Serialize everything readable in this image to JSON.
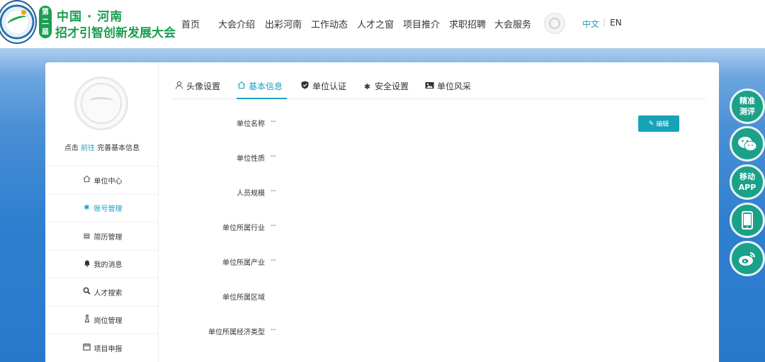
{
  "header": {
    "badge": "第二届",
    "logo_line1": "中国 · 河南",
    "logo_line2": "招才引智创新发展大会",
    "nav": [
      "首页",
      "大会介绍",
      "出彩河南",
      "工作动态",
      "人才之窗",
      "项目推介",
      "求职招聘",
      "大会服务"
    ],
    "lang_zh": "中文",
    "lang_sep": "|",
    "lang_en": "EN"
  },
  "sidebar": {
    "prompt_prefix": "点击",
    "prompt_link": "前往",
    "prompt_suffix": "完善基本信息",
    "items": [
      {
        "label": "单位中心",
        "icon": "home-icon",
        "active": false
      },
      {
        "label": "账号管理",
        "icon": "gear-icon",
        "active": true
      },
      {
        "label": "简历管理",
        "icon": "list-icon",
        "active": false
      },
      {
        "label": "我的消息",
        "icon": "bell-icon",
        "active": false
      },
      {
        "label": "人才搜索",
        "icon": "search-icon",
        "active": false
      },
      {
        "label": "岗位管理",
        "icon": "flask-icon",
        "active": false
      },
      {
        "label": "项目申报",
        "icon": "calendar-icon",
        "active": false
      }
    ]
  },
  "tabs": [
    {
      "label": "头像设置",
      "icon": "user-icon",
      "active": false
    },
    {
      "label": "基本信息",
      "icon": "home-icon",
      "active": true
    },
    {
      "label": "单位认证",
      "icon": "shield-icon",
      "active": false
    },
    {
      "label": "安全设置",
      "icon": "gear-icon",
      "active": false
    },
    {
      "label": "单位风采",
      "icon": "image-icon",
      "active": false
    }
  ],
  "form": {
    "edit_label": "编辑",
    "fields": [
      {
        "label": "单位名称",
        "value": "--"
      },
      {
        "label": "单位性质",
        "value": "--"
      },
      {
        "label": "人员规模",
        "value": "--"
      },
      {
        "label": "单位所属行业",
        "value": "--"
      },
      {
        "label": "单位所属产业",
        "value": "--"
      },
      {
        "label": "单位所属区域",
        "value": ""
      },
      {
        "label": "单位所属经济类型",
        "value": "--"
      }
    ]
  },
  "float_buttons": [
    {
      "label": "精准\n测评",
      "icon": ""
    },
    {
      "label": "",
      "icon": "wechat-icon"
    },
    {
      "label": "移动\nAPP",
      "icon": ""
    },
    {
      "label": "",
      "icon": "mobile-icon"
    },
    {
      "label": "",
      "icon": "weibo-icon"
    }
  ],
  "colors": {
    "accent": "#1aa0c8",
    "brand_green": "#1a9e50",
    "float_green": "#1aa189",
    "band_blue": "#2f7fd0"
  }
}
